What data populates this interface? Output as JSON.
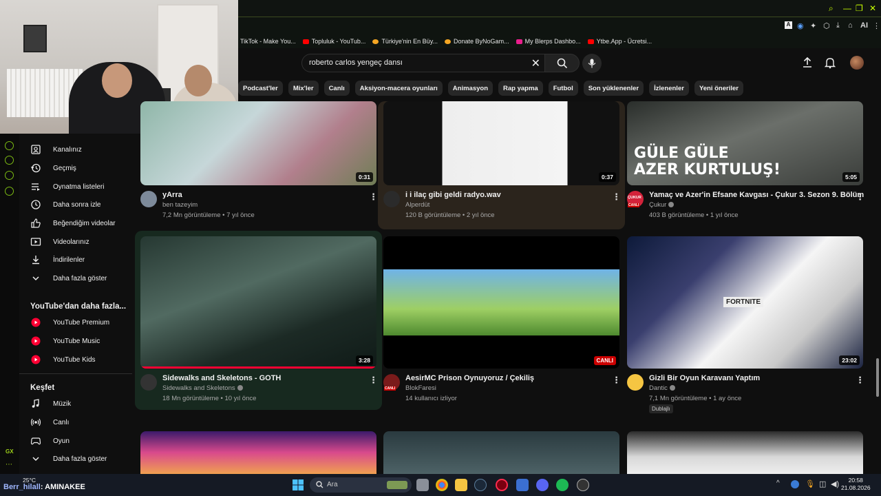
{
  "browser": {
    "bookmarks": [
      {
        "label": "TikTok - Make You...",
        "type": "none"
      },
      {
        "label": "Topluluk - YouTub...",
        "type": "red"
      },
      {
        "label": "Türkiye'nin En Büy...",
        "type": "org"
      },
      {
        "label": "Donate ByNoGam...",
        "type": "org"
      },
      {
        "label": "My Blerps Dashbo...",
        "type": "mag"
      },
      {
        "label": "Ytbe.App - Ücretsi...",
        "type": "red"
      }
    ],
    "ai_label": "AI",
    "accent_color": "#c8ff00"
  },
  "search": {
    "query": "roberto carlos yengeç dansı"
  },
  "chips": [
    "Podcast'ler",
    "Mix'ler",
    "Canlı",
    "Aksiyon-macera oyunları",
    "Animasyon",
    "Rap yapma",
    "Futbol",
    "Son yüklenenler",
    "İzlenenler",
    "Yeni öneriler"
  ],
  "sidebar": {
    "you_items": [
      {
        "label": "Kanalınız",
        "icon": "channel-icon"
      },
      {
        "label": "Geçmiş",
        "icon": "history-icon"
      },
      {
        "label": "Oynatma listeleri",
        "icon": "playlist-icon"
      },
      {
        "label": "Daha sonra izle",
        "icon": "clock-icon"
      },
      {
        "label": "Beğendiğim videolar",
        "icon": "like-icon"
      },
      {
        "label": "Videolarınız",
        "icon": "video-icon"
      },
      {
        "label": "İndirilenler",
        "icon": "download-icon"
      },
      {
        "label": "Daha fazla göster",
        "icon": "chevron-down-icon"
      }
    ],
    "more_header": "YouTube'dan daha fazla...",
    "more_items": [
      {
        "label": "YouTube Premium"
      },
      {
        "label": "YouTube Music"
      },
      {
        "label": "YouTube Kids"
      }
    ],
    "explore_header": "Keşfet",
    "explore_items": [
      {
        "label": "Müzik",
        "icon": "music-icon"
      },
      {
        "label": "Canlı",
        "icon": "live-icon"
      },
      {
        "label": "Oyun",
        "icon": "gaming-icon"
      },
      {
        "label": "Daha fazla göster",
        "icon": "chevron-down-icon"
      }
    ]
  },
  "videos": [
    {
      "title": "yArra",
      "channel": "ben tazeyim",
      "meta": "7,2 Mn görüntüleme • 7 yıl önce",
      "duration": "0:31"
    },
    {
      "title": "i i ilaç gibi geldi radyo.wav",
      "channel": "Alperdüt",
      "meta": "120 B görüntüleme • 2 yıl önce",
      "duration": "0:37"
    },
    {
      "title": "Yamaç ve Azer'in Efsane Kavgası - Çukur 3. Sezon 9. Bölüm",
      "channel": "Çukur",
      "meta": "403 B görüntüleme • 1 yıl önce",
      "duration": "5:05",
      "thumb_text": "GÜLE GÜLE\nAZER KURTULUŞ!",
      "avatar_text": "ÇUKUR",
      "avatar_badge": "CANLI"
    },
    {
      "title": "Sidewalks and Skeletons - GOTH",
      "channel": "Sidewalks and Skeletons",
      "meta": "18 Mn görüntüleme • 10 yıl önce",
      "duration": "3:28"
    },
    {
      "title": "AesirMC Prison Oynuyoruz / Çekiliş",
      "channel": "BlokFaresi",
      "meta": "14 kullanıcı izliyor",
      "live_label": "CANLI",
      "avatar_badge": "CANLI"
    },
    {
      "title": "Gizli Bir Oyun Karavanı Yaptım",
      "channel": "Dantic",
      "meta": "7,1 Mn görüntüleme • 1 ay önce",
      "duration": "23:02",
      "badge": "Dublajlı",
      "thumb_text": "FORTNITE"
    }
  ],
  "taskbar": {
    "search_placeholder": "Ara",
    "time": "20:58",
    "date": "21.08.2026",
    "weather": "25°C"
  },
  "overlay": {
    "chat_name": "Berr_hilall",
    "chat_text": ": AMINAKEE",
    "gx_label": "GX"
  }
}
